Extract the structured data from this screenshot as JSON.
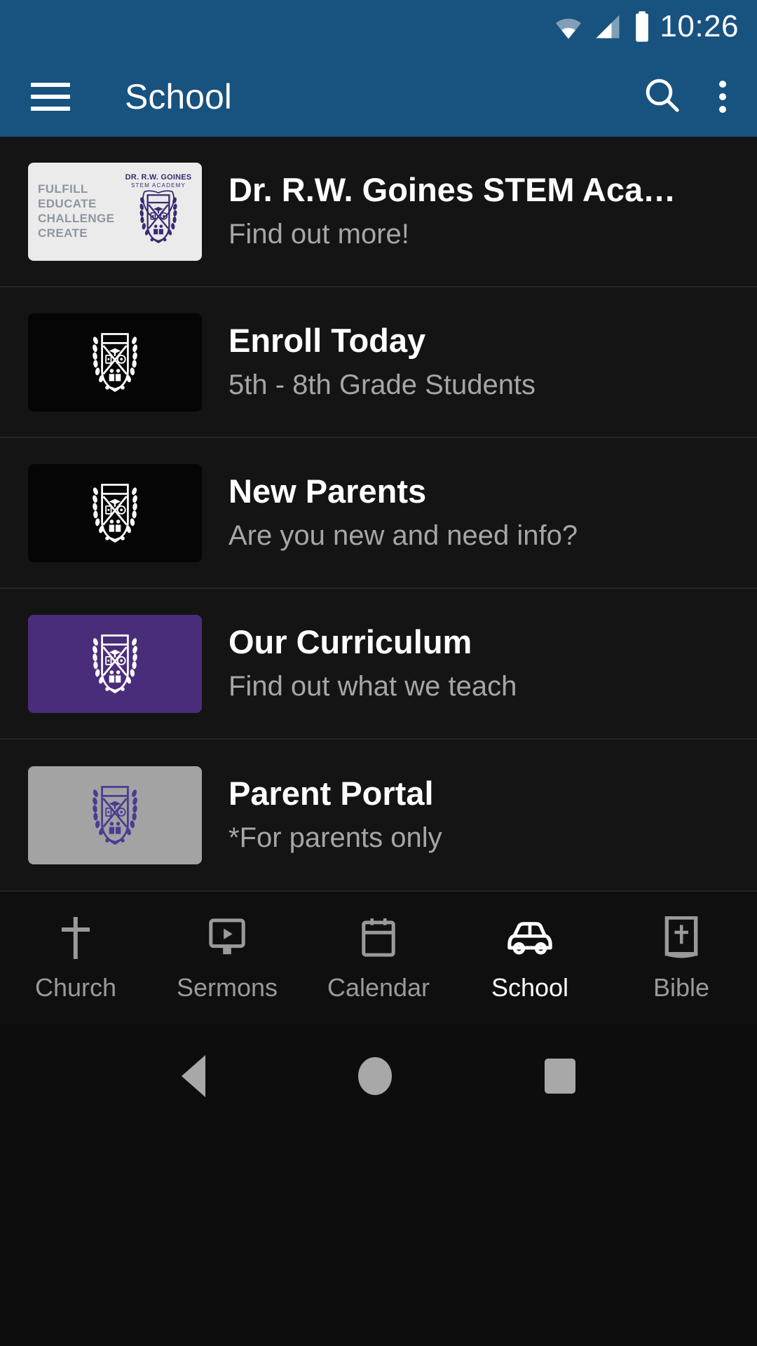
{
  "status_bar": {
    "time": "10:26",
    "icons": [
      "wifi-icon",
      "cellular-signal-icon",
      "battery-icon"
    ]
  },
  "app_bar": {
    "menu_icon": "hamburger-menu-icon",
    "title": "School",
    "search_icon": "search-icon",
    "overflow_icon": "more-vertical-icon",
    "background_color": "#18527f"
  },
  "list": {
    "items": [
      {
        "title": "Dr. R.W. Goines STEM Aca…",
        "subtitle": "Find out more!",
        "thumbnail": {
          "type": "banner",
          "background_color": "#ebebeb",
          "words": [
            "FULFILL",
            "EDUCATE",
            "CHALLENGE",
            "CREATE"
          ],
          "crest_title": "DR. R.W. GOINES",
          "crest_subtitle": "STEM ACADEMY",
          "crest_color": "#3b2b72"
        }
      },
      {
        "title": "Enroll Today",
        "subtitle": "5th - 8th Grade Students",
        "thumbnail": {
          "type": "crest",
          "background_color": "#050505",
          "crest_color": "#ffffff"
        }
      },
      {
        "title": "New Parents",
        "subtitle": "Are you new and need info?",
        "thumbnail": {
          "type": "crest",
          "background_color": "#050505",
          "crest_color": "#ffffff"
        }
      },
      {
        "title": "Our Curriculum",
        "subtitle": "Find out what we teach",
        "thumbnail": {
          "type": "crest",
          "background_color": "#4a2d7a",
          "crest_color": "#ffffff"
        }
      },
      {
        "title": "Parent Portal",
        "subtitle": "*For parents only",
        "thumbnail": {
          "type": "crest",
          "background_color": "#a3a3a3",
          "crest_color": "#4a3c92"
        }
      }
    ]
  },
  "tab_bar": {
    "active_color": "#ffffff",
    "inactive_color": "#9a9a9a",
    "tabs": [
      {
        "label": "Church",
        "icon": "cross-icon",
        "active": false
      },
      {
        "label": "Sermons",
        "icon": "video-play-icon",
        "active": false
      },
      {
        "label": "Calendar",
        "icon": "calendar-icon",
        "active": false
      },
      {
        "label": "School",
        "icon": "car-icon",
        "active": true
      },
      {
        "label": "Bible",
        "icon": "bible-book-icon",
        "active": false
      }
    ]
  },
  "system_nav": {
    "back": "back-triangle-icon",
    "home": "home-circle-icon",
    "recents": "recents-square-icon"
  }
}
